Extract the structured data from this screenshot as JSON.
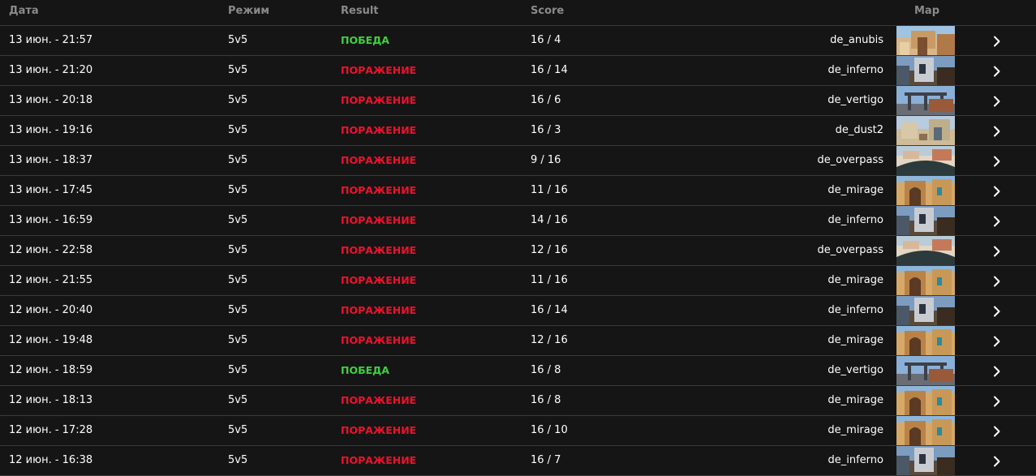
{
  "header": {
    "date": "Дата",
    "mode": "Режим",
    "result": "Result",
    "score": "Score",
    "map": "Map"
  },
  "colors": {
    "win": "#3fd03f",
    "loss": "#f0102c",
    "background": "#151515",
    "divider": "#3a3a3a",
    "header_text": "#8a8a8a"
  },
  "matches": [
    {
      "date": "13 июн. - 21:57",
      "mode": "5v5",
      "result": "ПОБЕДА",
      "outcome": "win",
      "score": "16 / 4",
      "map": "de_anubis",
      "thumb_icon": "anubis-map-thumbnail"
    },
    {
      "date": "13 июн. - 21:20",
      "mode": "5v5",
      "result": "ПОРАЖЕНИЕ",
      "outcome": "loss",
      "score": "16 / 14",
      "map": "de_inferno",
      "thumb_icon": "inferno-map-thumbnail"
    },
    {
      "date": "13 июн. - 20:18",
      "mode": "5v5",
      "result": "ПОРАЖЕНИЕ",
      "outcome": "loss",
      "score": "16 / 6",
      "map": "de_vertigo",
      "thumb_icon": "vertigo-map-thumbnail"
    },
    {
      "date": "13 июн. - 19:16",
      "mode": "5v5",
      "result": "ПОРАЖЕНИЕ",
      "outcome": "loss",
      "score": "16 / 3",
      "map": "de_dust2",
      "thumb_icon": "dust2-map-thumbnail"
    },
    {
      "date": "13 июн. - 18:37",
      "mode": "5v5",
      "result": "ПОРАЖЕНИЕ",
      "outcome": "loss",
      "score": "9 / 16",
      "map": "de_overpass",
      "thumb_icon": "overpass-map-thumbnail"
    },
    {
      "date": "13 июн. - 17:45",
      "mode": "5v5",
      "result": "ПОРАЖЕНИЕ",
      "outcome": "loss",
      "score": "11 / 16",
      "map": "de_mirage",
      "thumb_icon": "mirage-map-thumbnail"
    },
    {
      "date": "13 июн. - 16:59",
      "mode": "5v5",
      "result": "ПОРАЖЕНИЕ",
      "outcome": "loss",
      "score": "14 / 16",
      "map": "de_inferno",
      "thumb_icon": "inferno-map-thumbnail"
    },
    {
      "date": "12 июн. - 22:58",
      "mode": "5v5",
      "result": "ПОРАЖЕНИЕ",
      "outcome": "loss",
      "score": "12 / 16",
      "map": "de_overpass",
      "thumb_icon": "overpass-map-thumbnail"
    },
    {
      "date": "12 июн. - 21:55",
      "mode": "5v5",
      "result": "ПОРАЖЕНИЕ",
      "outcome": "loss",
      "score": "11 / 16",
      "map": "de_mirage",
      "thumb_icon": "mirage-map-thumbnail"
    },
    {
      "date": "12 июн. - 20:40",
      "mode": "5v5",
      "result": "ПОРАЖЕНИЕ",
      "outcome": "loss",
      "score": "16 / 14",
      "map": "de_inferno",
      "thumb_icon": "inferno-map-thumbnail"
    },
    {
      "date": "12 июн. - 19:48",
      "mode": "5v5",
      "result": "ПОРАЖЕНИЕ",
      "outcome": "loss",
      "score": "12 / 16",
      "map": "de_mirage",
      "thumb_icon": "mirage-map-thumbnail"
    },
    {
      "date": "12 июн. - 18:59",
      "mode": "5v5",
      "result": "ПОБЕДА",
      "outcome": "win",
      "score": "16 / 8",
      "map": "de_vertigo",
      "thumb_icon": "vertigo-map-thumbnail"
    },
    {
      "date": "12 июн. - 18:13",
      "mode": "5v5",
      "result": "ПОРАЖЕНИЕ",
      "outcome": "loss",
      "score": "16 / 8",
      "map": "de_mirage",
      "thumb_icon": "mirage-map-thumbnail"
    },
    {
      "date": "12 июн. - 17:28",
      "mode": "5v5",
      "result": "ПОРАЖЕНИЕ",
      "outcome": "loss",
      "score": "16 / 10",
      "map": "de_mirage",
      "thumb_icon": "mirage-map-thumbnail"
    },
    {
      "date": "12 июн. - 16:38",
      "mode": "5v5",
      "result": "ПОРАЖЕНИЕ",
      "outcome": "loss",
      "score": "16 / 7",
      "map": "de_inferno",
      "thumb_icon": "inferno-map-thumbnail"
    }
  ]
}
